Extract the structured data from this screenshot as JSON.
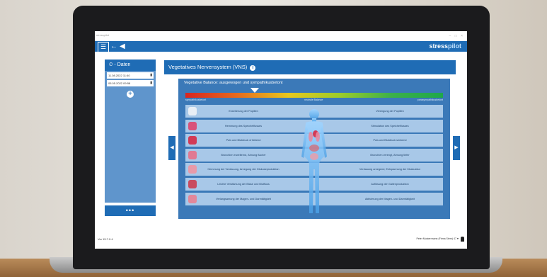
{
  "app": {
    "brand_prefix": "stress",
    "brand_suffix": "pilot",
    "window_title": "stresspilot",
    "window_controls": "– □ ×"
  },
  "left_panel": {
    "header": "Daten",
    "dates": [
      "11.08.2022 11:40",
      "05.05.2022 09:58"
    ],
    "more_label": "•••"
  },
  "main": {
    "title": "Vegetatives Nervensystem (VNS)",
    "balance_title": "Vegetative Balance: ausgewogen und sympathikusbetont",
    "gauge_labels": {
      "left": "sympathikusbetont",
      "center": "neutrale Balance",
      "right": "parasympathikusbetont"
    },
    "gauge_position": 0.27,
    "rows": [
      {
        "left": "Erweiterung der Pupillen",
        "right": "Verengung der Pupillen",
        "organ": "eye"
      },
      {
        "left": "Hemmung des Speichelflusses",
        "right": "Stimulation des Speichelflusses",
        "organ": "mouth"
      },
      {
        "left": "Puls und Blutdruck erhöhend",
        "right": "Puls und Blutdruck senkend",
        "organ": "heart"
      },
      {
        "left": "Bronchien erweiternd, Atmung flacher",
        "right": "Bronchien verengt, Atmung tiefer",
        "organ": "lungs"
      },
      {
        "left": "Hemmung der Verdauung, Anregung der Glukoseproduktion",
        "right": "Verdauung anregend, Entspannung der Muskulatur",
        "organ": "stomach"
      },
      {
        "left": "Leichte Verstärkung der Blase und Blutfluss",
        "right": "Auflösung der Gallenproduktion",
        "organ": "liver"
      },
      {
        "left": "Verlangsamung der Magen- und Darmtätigkeit",
        "right": "Aktivierung der Magen- und Darmtätigkeit",
        "organ": "intestine"
      }
    ]
  },
  "status": {
    "left": "Ver 15.7.0.4",
    "right": "Peter Musterrmann (Firma Stern) 47 ♥"
  },
  "colors": {
    "primary": "#1f6cb5",
    "panel": "#3b79b8",
    "row": "#a8c8e8"
  }
}
